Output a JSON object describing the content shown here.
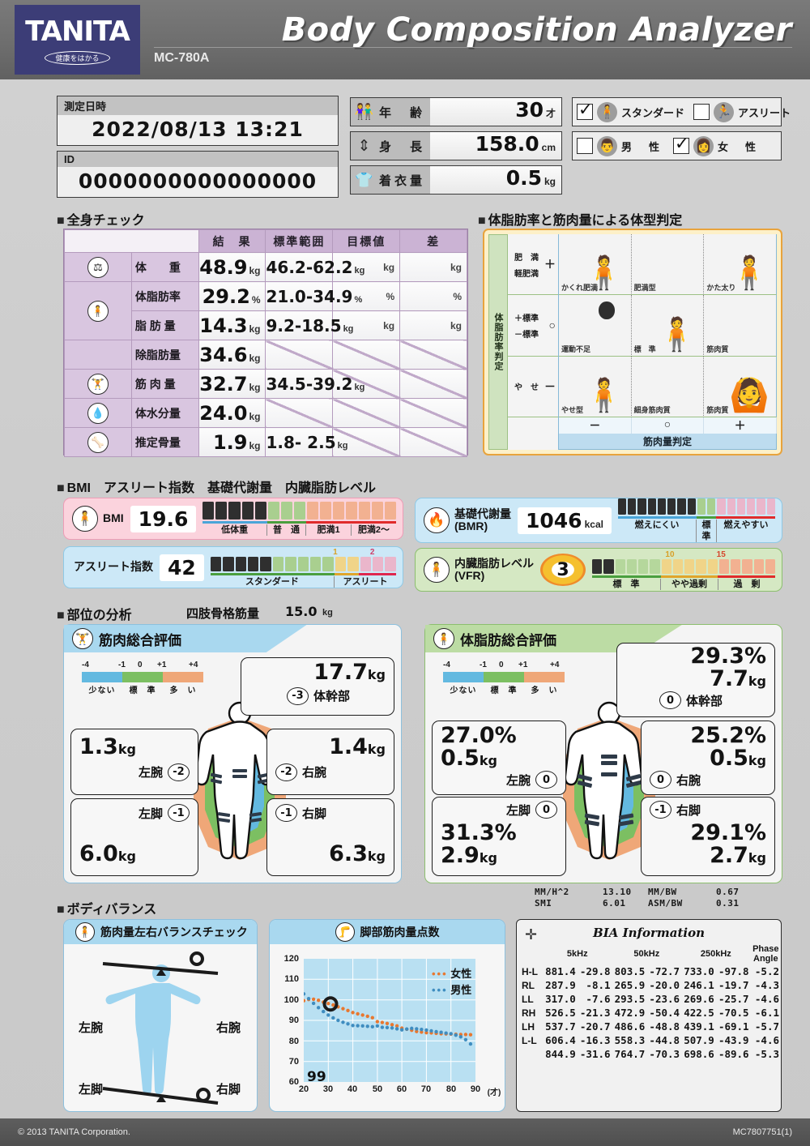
{
  "header": {
    "brand": "TANITA",
    "brand_tagline": "健康をはかる",
    "title": "Body Composition Analyzer",
    "model": "MC-780A"
  },
  "topinfo": {
    "datetime_label": "測定日時",
    "datetime_value": "2022/08/13  13:21",
    "id_label": "ID",
    "id_value": "0000000000000000",
    "age_label": "年　齢",
    "age_value": "30",
    "age_unit": "才",
    "height_label": "身　長",
    "height_value": "158.0",
    "height_unit": "cm",
    "clothing_label": "着衣量",
    "clothing_value": "0.5",
    "clothing_unit": "kg",
    "standard_label": "スタンダード",
    "standard_checked": true,
    "athlete_label": "アスリート",
    "athlete_checked": false,
    "male_label": "男　性",
    "male_checked": false,
    "female_label": "女　性",
    "female_checked": true
  },
  "wholebody": {
    "heading": "全身チェック",
    "columns": [
      "",
      "結　果",
      "標準範囲",
      "目標値",
      "差"
    ],
    "rows": [
      {
        "icon": "weight-icon",
        "label": "体　　重",
        "result": "48.9",
        "unit": "kg",
        "range": "46.2-62.2",
        "range_unit": "kg",
        "target_unit": "kg",
        "diff_unit": "kg"
      },
      {
        "icon": "bodyfat-icon",
        "label": "体脂肪率",
        "result": "29.2",
        "unit": "%",
        "range": "21.0-34.9",
        "range_unit": "%",
        "target_unit": "%",
        "diff_unit": "%"
      },
      {
        "icon": "",
        "label": "脂 肪 量",
        "result": "14.3",
        "unit": "kg",
        "range": "9.2-18.5",
        "range_unit": "kg",
        "target_unit": "kg",
        "diff_unit": "kg"
      },
      {
        "icon": "",
        "label": "除脂肪量",
        "result": "34.6",
        "unit": "kg",
        "range": "",
        "range_unit": "",
        "target_unit": "",
        "diff_unit": ""
      },
      {
        "icon": "muscle-icon",
        "label": "筋 肉 量",
        "result": "32.7",
        "unit": "kg",
        "range": "34.5-39.2",
        "range_unit": "kg",
        "target_unit": "",
        "diff_unit": ""
      },
      {
        "icon": "water-icon",
        "label": "体水分量",
        "result": "24.0",
        "unit": "kg",
        "range": "",
        "range_unit": "",
        "target_unit": "",
        "diff_unit": ""
      },
      {
        "icon": "bone-icon",
        "label": "推定骨量",
        "result": "1.9",
        "unit": "kg",
        "range": "1.8- 2.5",
        "range_unit": "kg",
        "target_unit": "",
        "diff_unit": ""
      }
    ]
  },
  "bodytype": {
    "heading": "体脂肪率と筋肉量による体型判定",
    "y_axis_label": "体脂肪率判定",
    "x_axis_label": "筋肉量判定",
    "row_labels": [
      {
        "top": "肥　満",
        "bottom": "軽肥満",
        "sign": "＋"
      },
      {
        "top": "＋標準",
        "bottom": "－標準",
        "sign": "○"
      },
      {
        "top": "や　せ",
        "bottom": "",
        "sign": "－"
      }
    ],
    "x_ticks": [
      "－",
      "○",
      "＋"
    ],
    "cells": [
      [
        "かくれ肥満",
        "肥満型",
        "かた太り"
      ],
      [
        "運動不足",
        "標　準",
        "筋肉質"
      ],
      [
        "やせ型",
        "細身筋肉質",
        "筋肉質"
      ]
    ],
    "marker_cell": "運動不足"
  },
  "indices": {
    "heading": "BMI　アスリート指数　基礎代謝量　内臓脂肪レベル",
    "bmi": {
      "label": "BMI",
      "value": "19.6",
      "unit": "",
      "segments": [
        "低体重",
        "普　通",
        "肥満1",
        "肥満2～"
      ],
      "segment_weights": [
        5,
        3,
        3.5,
        3.5
      ],
      "filled": 5,
      "total": 15
    },
    "athlete": {
      "label": "アスリート指数",
      "value": "42",
      "unit": "",
      "segments": [
        "スタンダード",
        "アスリート"
      ],
      "segment_weights": [
        10,
        5
      ],
      "tick_labels": [
        "1",
        "2"
      ],
      "filled": 5,
      "total": 15
    },
    "bmr": {
      "label_line1": "基礎代謝量",
      "label_line2": "(BMR)",
      "value": "1046",
      "unit": "kcal",
      "segments": [
        "燃えにくい",
        "標　準",
        "燃えやすい"
      ],
      "segment_weights": [
        8,
        2,
        6
      ],
      "filled": 8,
      "total": 16
    },
    "vfr": {
      "label_line1": "内臓脂肪レベル",
      "label_line2": "(VFR)",
      "value": "3",
      "unit": "",
      "segments": [
        "標　準",
        "やや過剰",
        "過　剰"
      ],
      "segment_weights": [
        6,
        5,
        5
      ],
      "tick_labels": [
        "10",
        "15"
      ],
      "filled": 2,
      "total": 16
    }
  },
  "segmental": {
    "heading": "部位の分析",
    "asm_label": "四肢骨格筋量",
    "asm_value": "15.0",
    "asm_unit": "kg",
    "legend": {
      "ticks": [
        "-4",
        "-1",
        "0",
        "+1",
        "+4"
      ],
      "labels": [
        "少ない",
        "標　準",
        "多　い"
      ]
    },
    "muscle": {
      "title": "筋肉総合評価",
      "trunk": {
        "label": "体幹部",
        "value": "17.7",
        "unit": "kg",
        "score": "-3"
      },
      "left_arm": {
        "label": "左腕",
        "value": "1.3",
        "unit": "kg",
        "score": "-2"
      },
      "right_arm": {
        "label": "右腕",
        "value": "1.4",
        "unit": "kg",
        "score": "-2"
      },
      "left_leg": {
        "label": "左脚",
        "value": "6.0",
        "unit": "kg",
        "score": "-1"
      },
      "right_leg": {
        "label": "右脚",
        "value": "6.3",
        "unit": "kg",
        "score": "-1"
      }
    },
    "fat": {
      "title": "体脂肪総合評価",
      "trunk": {
        "label": "体幹部",
        "pct": "29.3%",
        "mass": "7.7",
        "unit": "kg",
        "score": "0"
      },
      "left_arm": {
        "label": "左腕",
        "pct": "27.0%",
        "mass": "0.5",
        "unit": "kg",
        "score": "0"
      },
      "right_arm": {
        "label": "右腕",
        "pct": "25.2%",
        "mass": "0.5",
        "unit": "kg",
        "score": "0"
      },
      "left_leg": {
        "label": "左脚",
        "pct": "31.3%",
        "mass": "2.9",
        "unit": "kg",
        "score": "0"
      },
      "right_leg": {
        "label": "右脚",
        "pct": "29.1%",
        "mass": "2.7",
        "unit": "kg",
        "score": "-1"
      }
    },
    "indices": [
      {
        "name": "MM/H^2",
        "value": "13.10"
      },
      {
        "name": "SMI",
        "value": "6.01"
      },
      {
        "name": "MM/BW",
        "value": "0.67"
      },
      {
        "name": "ASM/BW",
        "value": "0.31"
      }
    ]
  },
  "balance": {
    "heading": "ボディバランス",
    "check_title": "筋肉量左右バランスチェック",
    "left_arm": "左腕",
    "right_arm": "右腕",
    "left_leg": "左脚",
    "right_leg": "右脚"
  },
  "chart_data": {
    "type": "scatter",
    "title": "脚部筋肉量点数",
    "xlabel": "(才)",
    "ylabel": "",
    "xlim": [
      20,
      90
    ],
    "ylim": [
      60,
      120
    ],
    "yticks": [
      60,
      70,
      80,
      90,
      100,
      110,
      120
    ],
    "xticks": [
      20,
      30,
      40,
      50,
      60,
      70,
      80,
      90
    ],
    "grid": true,
    "legend": [
      "女性",
      "男性"
    ],
    "legend_position": "top-right",
    "user_score": "99",
    "user_point": {
      "x": 31,
      "y": 98
    },
    "series": [
      {
        "name": "女性",
        "color": "#e8772f",
        "x": [
          20,
          22,
          24,
          26,
          28,
          30,
          32,
          34,
          36,
          38,
          40,
          42,
          44,
          46,
          48,
          50,
          52,
          54,
          56,
          58,
          60,
          62,
          64,
          66,
          68,
          70,
          72,
          74,
          76,
          78,
          80,
          82,
          84,
          86,
          88
        ],
        "y": [
          99.6,
          100.2,
          100.3,
          99.8,
          98.9,
          98.2,
          97.5,
          96.6,
          95.7,
          94.8,
          93.8,
          93.2,
          92.6,
          92.0,
          91.3,
          89.4,
          89.0,
          88.5,
          87.9,
          87.3,
          86.2,
          85.7,
          85.2,
          84.6,
          84.3,
          84.0,
          83.9,
          83.7,
          83.5,
          83.4,
          83.3,
          83.2,
          83.1,
          83.1,
          83.0
        ]
      },
      {
        "name": "男性",
        "color": "#3f8dc0",
        "x": [
          20,
          22,
          24,
          26,
          28,
          30,
          32,
          34,
          36,
          38,
          40,
          42,
          44,
          46,
          48,
          50,
          52,
          54,
          56,
          58,
          60,
          62,
          64,
          66,
          68,
          70,
          72,
          74,
          76,
          78,
          80,
          82,
          84,
          86,
          88
        ],
        "y": [
          102.9,
          100.6,
          98.3,
          96.2,
          94.3,
          92.6,
          91.2,
          90.0,
          89.1,
          88.3,
          87.5,
          87.4,
          87.3,
          87.1,
          86.9,
          87.3,
          86.6,
          86.5,
          86.3,
          85.9,
          85.4,
          85.8,
          86.1,
          85.9,
          85.6,
          85.3,
          84.9,
          84.5,
          84.2,
          83.8,
          83.5,
          82.8,
          82.0,
          80.6,
          78.5
        ]
      }
    ]
  },
  "bia": {
    "title": "BIA Information",
    "columns": [
      "5kHz",
      "50kHz",
      "250kHz",
      "Phase Angle"
    ],
    "phase_label_line1": "Phase",
    "phase_label_line2": "Angle",
    "rows": [
      {
        "name": "H-L",
        "v": [
          "881.4",
          "-29.8",
          "803.5",
          "-72.7",
          "733.0",
          "-97.8",
          "-5.2"
        ]
      },
      {
        "name": "RL",
        "v": [
          "287.9",
          "-8.1",
          "265.9",
          "-20.0",
          "246.1",
          "-19.7",
          "-4.3"
        ]
      },
      {
        "name": "LL",
        "v": [
          "317.0",
          "-7.6",
          "293.5",
          "-23.6",
          "269.6",
          "-25.7",
          "-4.6"
        ]
      },
      {
        "name": "RH",
        "v": [
          "526.5",
          "-21.3",
          "472.9",
          "-50.4",
          "422.5",
          "-70.5",
          "-6.1"
        ]
      },
      {
        "name": "LH",
        "v": [
          "537.7",
          "-20.7",
          "486.6",
          "-48.8",
          "439.1",
          "-69.1",
          "-5.7"
        ]
      },
      {
        "name": "L-L",
        "v": [
          "606.4",
          "-16.3",
          "558.3",
          "-44.8",
          "507.9",
          "-43.9",
          "-4.6"
        ]
      },
      {
        "name": "",
        "v": [
          "844.9",
          "-31.6",
          "764.7",
          "-70.3",
          "698.6",
          "-89.6",
          "-5.3"
        ]
      }
    ]
  },
  "footer": {
    "copyright": "© 2013 TANITA Corporation.",
    "doc_code": "MC7807751(1)"
  },
  "colors": {
    "brand_navy": "#3c3d77",
    "low_blue": "#63b9e0",
    "normal_green": "#7cbf62",
    "high_orange": "#efa778",
    "accent_pink": "#f5b9cb",
    "accent_yellow": "#f3d27a"
  }
}
